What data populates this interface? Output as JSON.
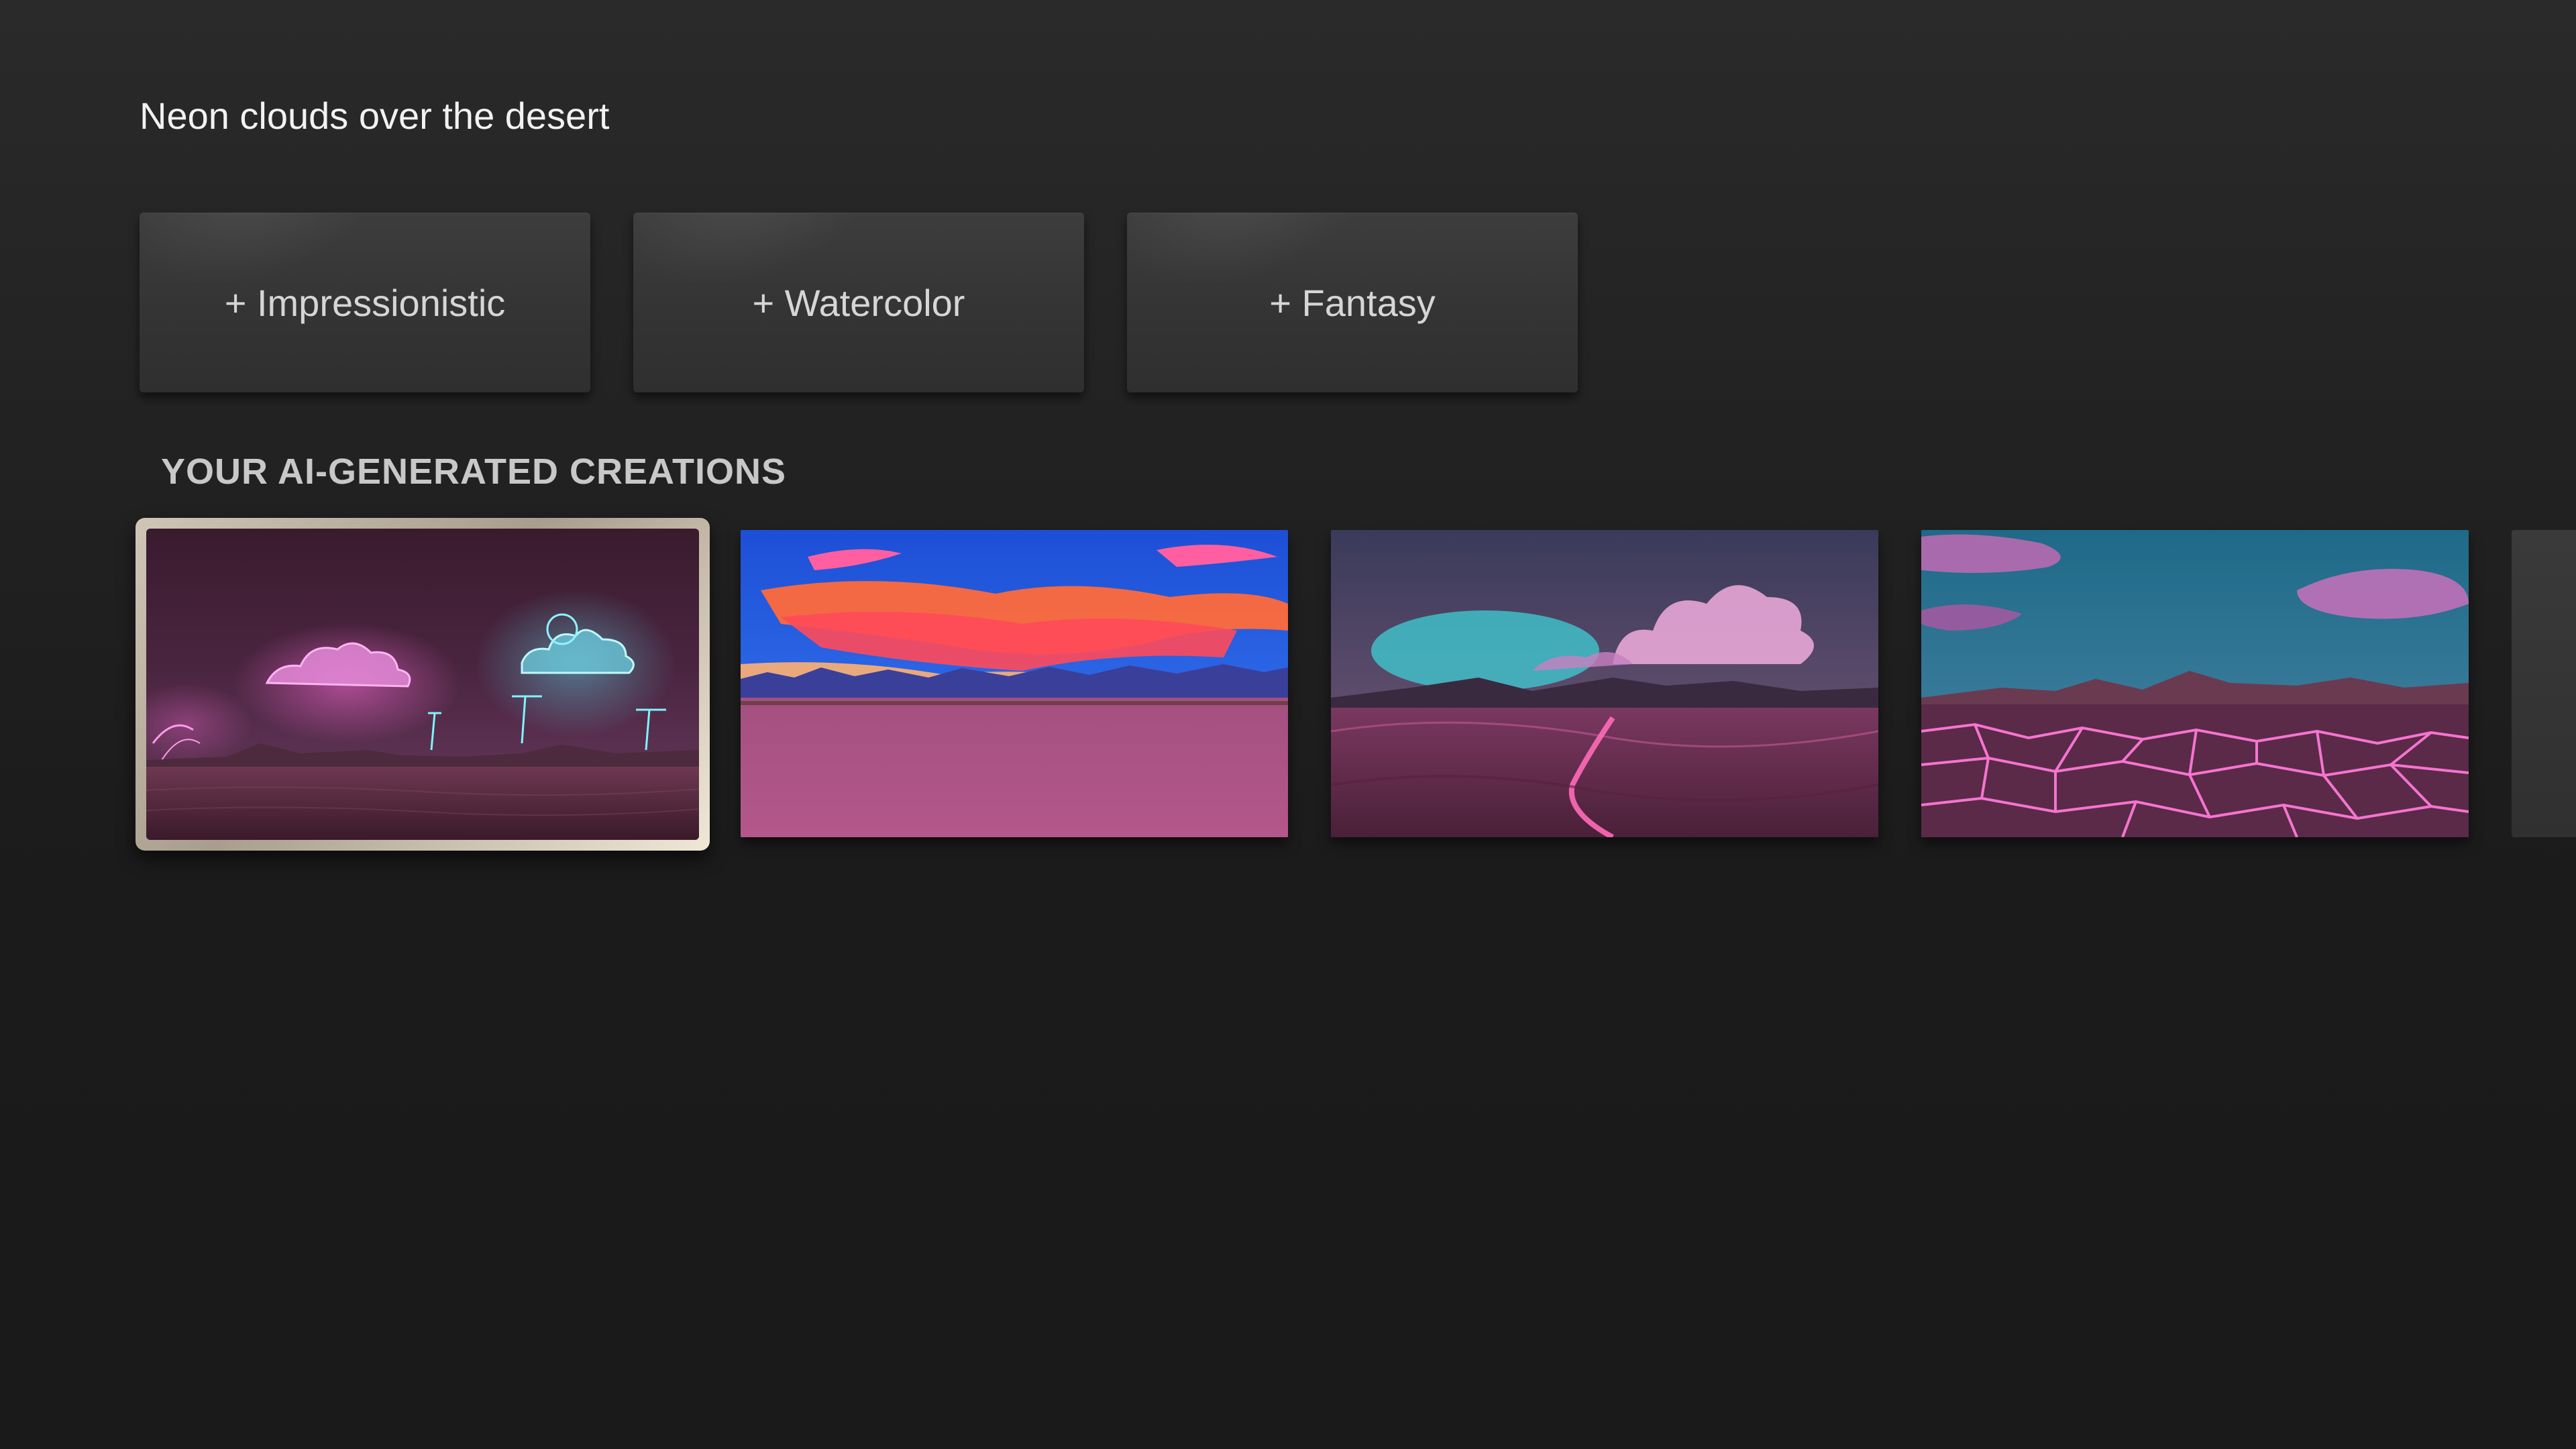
{
  "prompt": {
    "title": "Neon clouds over the desert"
  },
  "style_chips": [
    {
      "label": "+ Impressionistic"
    },
    {
      "label": "+ Watercolor"
    },
    {
      "label": "+ Fantasy"
    }
  ],
  "creations": {
    "section_title": "YOUR AI-GENERATED CREATIONS",
    "items": [
      {
        "name": "neon-clouds-lightning-desert",
        "focused": true
      },
      {
        "name": "sunset-clouds-desert",
        "focused": false
      },
      {
        "name": "teal-pink-clouds-dunes",
        "focused": false
      },
      {
        "name": "glowing-cracked-desert",
        "focused": false
      }
    ]
  },
  "colors": {
    "background": "#1b1b1b",
    "chip": "#363636",
    "focus_ring": "#e8dfcf",
    "text_primary": "#f2f2f2",
    "text_secondary": "#c8c8c8"
  }
}
